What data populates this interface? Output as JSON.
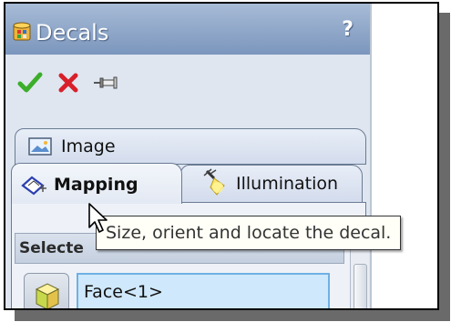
{
  "panel": {
    "title": "Decals",
    "help": "?",
    "icon": "decals-icon"
  },
  "toolbar": {
    "ok_icon": "checkmark-icon",
    "cancel_icon": "x-icon",
    "pin_icon": "pushpin-icon"
  },
  "tabs": [
    {
      "label": "Image",
      "icon": "image-icon",
      "active": false
    },
    {
      "label": "Mapping",
      "icon": "mapping-icon",
      "active": true
    },
    {
      "label": "Illumination",
      "icon": "illumination-icon",
      "active": false
    }
  ],
  "section": {
    "title": "Selecte"
  },
  "selection": {
    "items": [
      "Face<1>"
    ]
  },
  "tooltip": {
    "text": "Size, orient and locate the decal."
  },
  "colors": {
    "titlebar": "#7b96bd",
    "ok": "#3cae2a",
    "cancel": "#d8202a",
    "selection_border": "#6fb0e3"
  }
}
